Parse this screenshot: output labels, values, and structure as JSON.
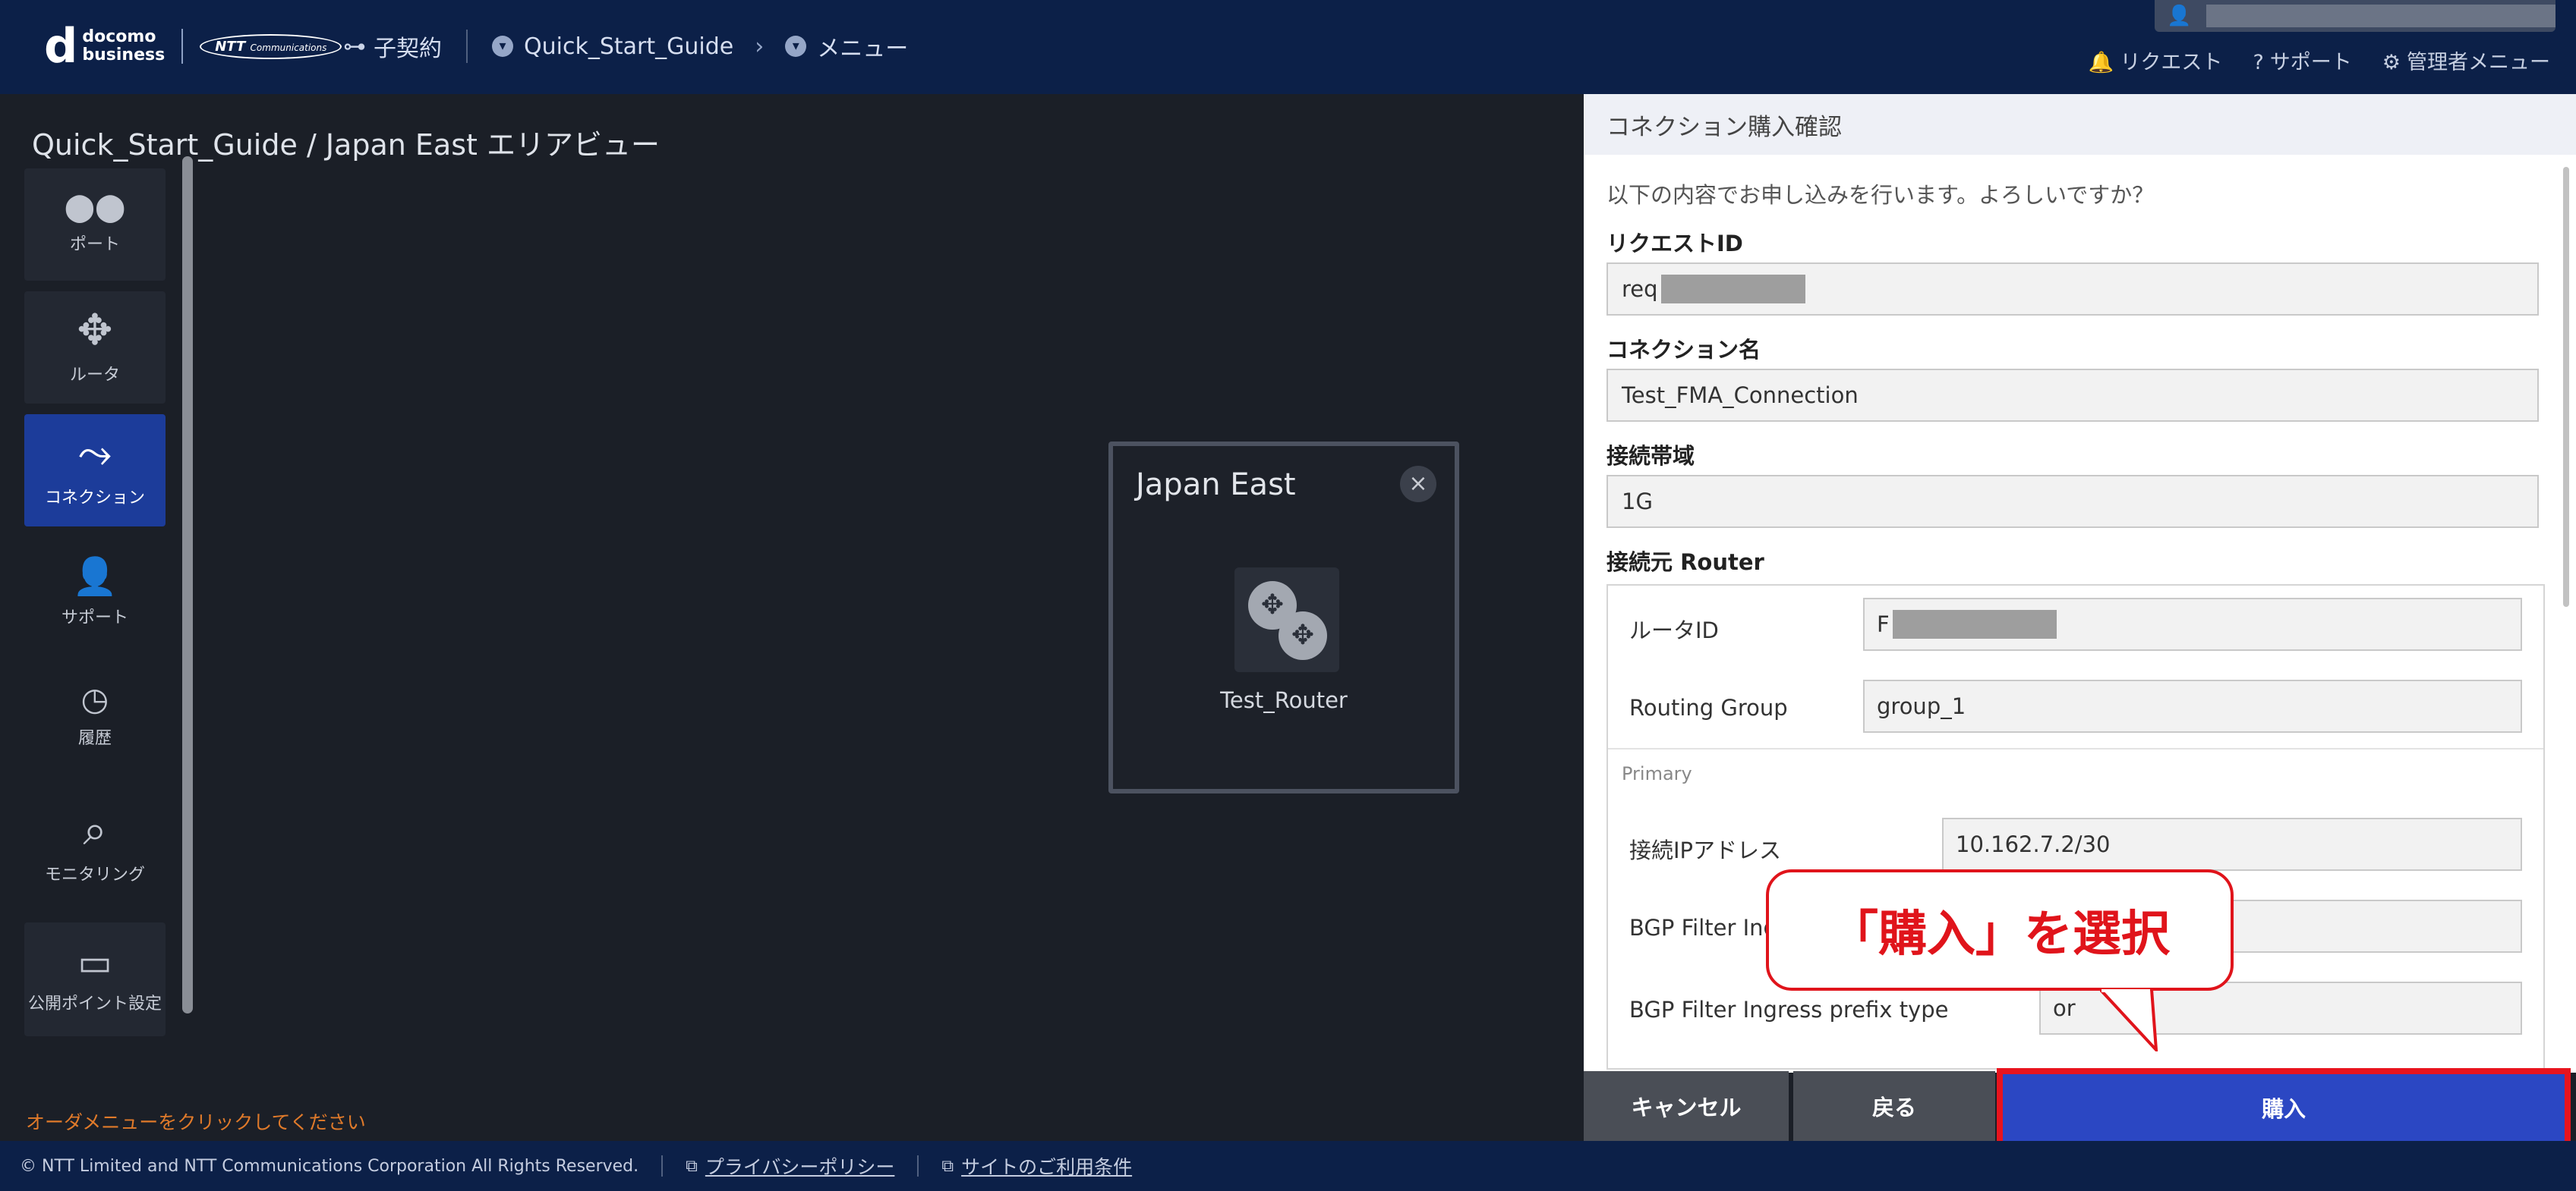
{
  "header": {
    "logo_main": "d",
    "logo_line1": "docomo",
    "logo_line2": "business",
    "logo_ntt": "NTT",
    "logo_ntt_sub": "Communications",
    "breadcrumbs": [
      {
        "label": "子契約"
      },
      {
        "label": "Quick_Start_Guide"
      },
      {
        "label": "メニュー"
      }
    ],
    "top_nav": [
      {
        "label": "リクエスト",
        "icon": "bell-icon"
      },
      {
        "label": "サポート",
        "icon": "help-icon"
      },
      {
        "label": "管理者メニュー",
        "icon": "gear-icon"
      }
    ]
  },
  "area": {
    "title": "Quick_Start_Guide / Japan East エリアビュー",
    "order_hint": "オーダメニューをクリックしてください"
  },
  "sidebar": {
    "items": [
      {
        "label": "ポート",
        "icon": "port-icon",
        "glyph": "⬤⬤"
      },
      {
        "label": "ルータ",
        "icon": "router-icon",
        "glyph": "✥"
      },
      {
        "label": "コネクション",
        "icon": "connection-icon",
        "glyph": "⤳",
        "active": true
      },
      {
        "label": "サポート",
        "icon": "support-user-icon",
        "glyph": "👤"
      },
      {
        "label": "履歴",
        "icon": "history-icon",
        "glyph": "◷"
      },
      {
        "label": "モニタリング",
        "icon": "monitoring-icon",
        "glyph": "⌕"
      },
      {
        "label": "公開ポイント設定",
        "icon": "public-point-icon",
        "glyph": "▭"
      }
    ]
  },
  "region": {
    "title": "Japan East",
    "close_glyph": "×",
    "router_label": "Test_Router"
  },
  "panel": {
    "title": "コネクション購入確認",
    "intro": "以下の内容でお申し込みを行います。よろしいですか？",
    "request_id_label": "リクエストID",
    "request_id_value": "req",
    "connection_name_label": "コネクション名",
    "connection_name_value": "Test_FMA_Connection",
    "bandwidth_label": "接続帯域",
    "bandwidth_value": "1G",
    "source_router_label": "接続元 Router",
    "router_id_label": "ルータID",
    "router_id_value": "F",
    "routing_group_label": "Routing Group",
    "routing_group_value": "group_1",
    "primary_label": "Primary",
    "ip_label": "接続IPアドレス",
    "ip_value": "10.162.7.2/30",
    "bgp_ingress_label": "BGP Filter Ing",
    "bgp_ingress_type_label": "BGP Filter Ingress prefix type",
    "bgp_ingress_type_value": "or"
  },
  "buttons": {
    "cancel": "キャンセル",
    "back": "戻る",
    "buy": "購入"
  },
  "callout": {
    "text": "「購入」を選択"
  },
  "footer": {
    "copyright": "© NTT Limited and NTT Communications Corporation All Rights Reserved.",
    "privacy": "プライバシーポリシー",
    "terms": "サイトのご利用条件"
  },
  "colors": {
    "header_bg": "#0c2048",
    "accent_blue": "#2b47c3",
    "highlight_red": "#e8141e",
    "hint_orange": "#e07a2a"
  }
}
